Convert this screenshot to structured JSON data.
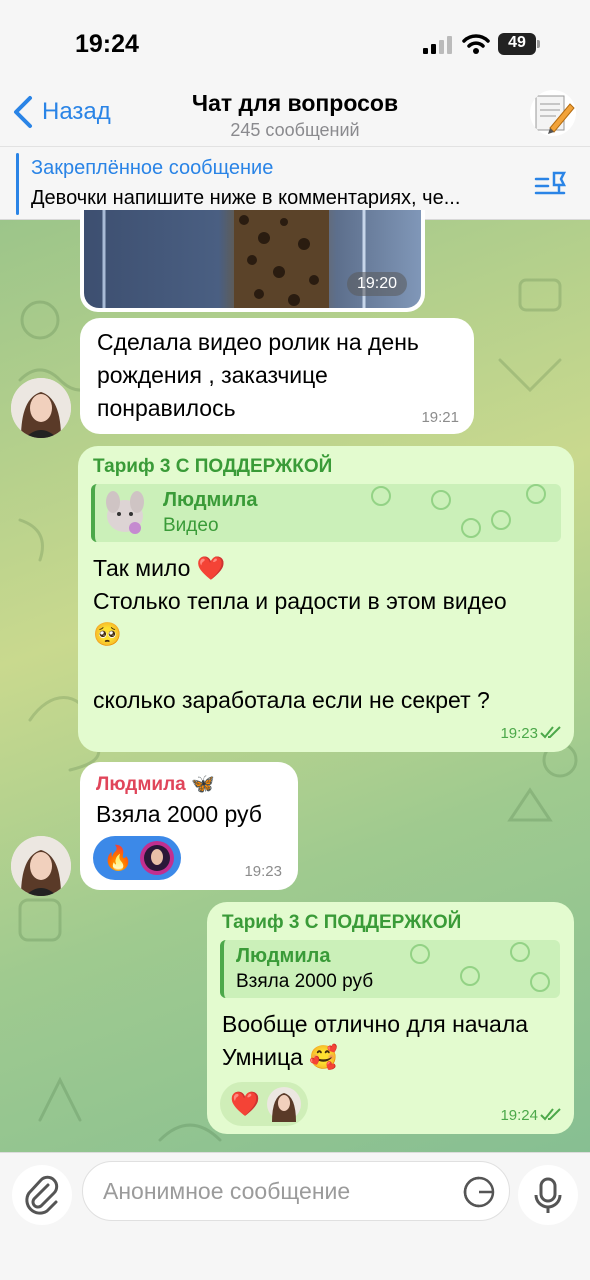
{
  "status_bar": {
    "time": "19:24",
    "battery": "49"
  },
  "header": {
    "back_label": "Назад",
    "title": "Чат для вопросов",
    "subtitle": "245 сообщений"
  },
  "pinned": {
    "title": "Закреплённое сообщение",
    "text": "Девочки напишите ниже в комментариях, че..."
  },
  "messages": [
    {
      "id": "video",
      "time": "19:20"
    },
    {
      "id": "m1",
      "text": "Сделала видео ролик на день\nрождения , заказчице\nпонравилось",
      "time": "19:21"
    },
    {
      "id": "m2",
      "sender": "Тариф 3 С ПОДДЕРЖКОЙ",
      "reply_name": "Людмила",
      "reply_text": "Видео",
      "text": "Так мило ❤️\nСтолько тепла и радости в этом видео\n🥺\n\nсколько заработала если не секрет ?",
      "time": "19:23"
    },
    {
      "id": "m3",
      "sender": "Людмила 🦋",
      "text": "Взяла 2000 руб",
      "reaction": "🔥",
      "time": "19:23"
    },
    {
      "id": "m4",
      "sender": "Тариф 3 С ПОДДЕРЖКОЙ",
      "reply_name": "Людмила",
      "reply_text": "Взяла 2000 руб",
      "text": "Вообще отлично для начала\nУмница 🥰",
      "reaction": "❤️",
      "time": "19:24"
    }
  ],
  "input": {
    "placeholder": "Анонимное сообщение"
  },
  "colors": {
    "accent": "#2a84e6",
    "outgoing_bubble": "#e3fbcf",
    "outgoing_name": "#3a9b38",
    "incoming_name": "#e0455a"
  }
}
